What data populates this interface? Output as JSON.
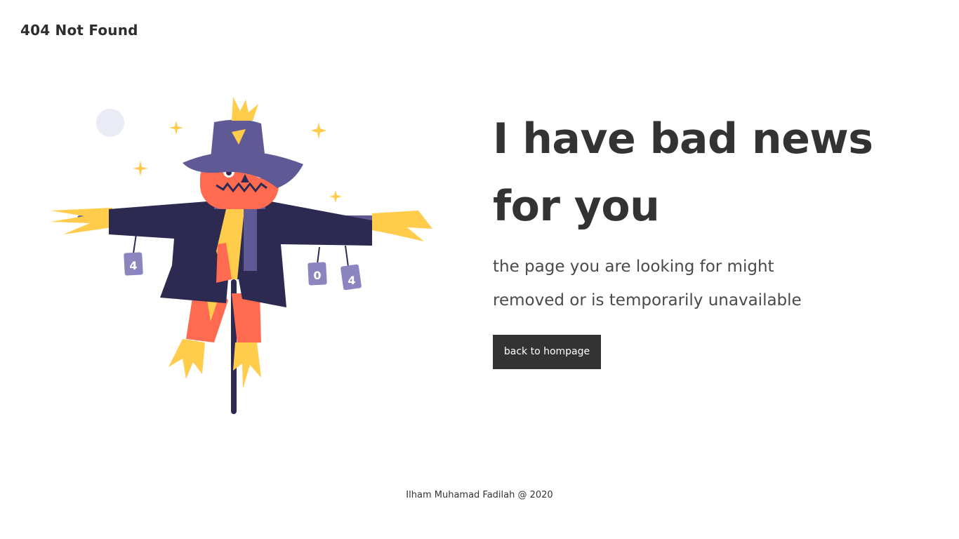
{
  "header": {
    "title": "404 Not Found"
  },
  "illustration": {
    "name": "scarecrow",
    "can_labels": [
      "4",
      "0",
      "4"
    ],
    "colors": {
      "hat": "#5f5a96",
      "coat": "#2d2a52",
      "face": "#ff6b50",
      "straw": "#ffcd4b",
      "scarf": "#5f5a96",
      "pole": "#2d2a52",
      "moon": "#e9ebf5",
      "sparkle": "#ffcd4b"
    }
  },
  "main": {
    "headline": "I have bad news for you",
    "message": "the page you are looking for might removed or is temporarily unavailable",
    "button_label": "back to hompage"
  },
  "footer": {
    "credit": "Ilham Muhamad Fadilah @ 2020"
  }
}
